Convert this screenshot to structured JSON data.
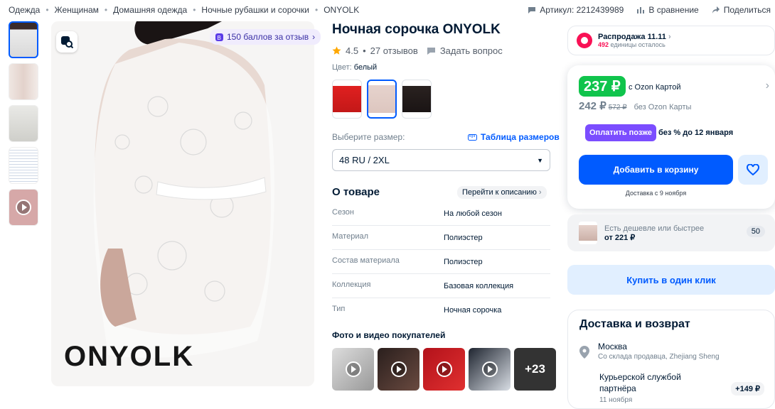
{
  "breadcrumbs": [
    "Одежда",
    "Женщинам",
    "Домашняя одежда",
    "Ночные рубашки и сорочки",
    "ONYOLK"
  ],
  "top_links": {
    "article": "Артикул: 2212439989",
    "compare": "В сравнение",
    "share": "Поделиться"
  },
  "gallery": {
    "points_badge": "150 баллов за отзыв",
    "brand_overlay": "ONYOLK"
  },
  "product": {
    "title": "Ночная сорочка ONYOLK",
    "rating": "4.5",
    "reviews": "27 отзывов",
    "ask": "Задать вопрос",
    "color_label": "Цвет:",
    "color_value": "белый",
    "size_label": "Выберите размер:",
    "size_table": "Таблица размеров",
    "size_selected": "48 RU / 2XL"
  },
  "about": {
    "title": "О товаре",
    "goto": "Перейти к описанию",
    "specs": [
      {
        "k": "Сезон",
        "v": "На любой сезон"
      },
      {
        "k": "Материал",
        "v": "Полиэстер"
      },
      {
        "k": "Состав материала",
        "v": "Полиэстер"
      },
      {
        "k": "Коллекция",
        "v": "Базовая коллекция"
      },
      {
        "k": "Тип",
        "v": "Ночная сорочка"
      }
    ]
  },
  "ugc": {
    "title": "Фото и видео покупателей",
    "more": "+23"
  },
  "sale": {
    "title": "Распродажа 11.11",
    "count": "492",
    "count_text": "единицы осталось"
  },
  "price": {
    "card_price": "237 ₽",
    "card_label": "с Ozon Картой",
    "price": "242 ₽",
    "old_price": "572 ₽",
    "no_card_label": "без Ozon Карты",
    "pay_later": "Оплатить позже",
    "pay_later_text": "без % до 12 января",
    "cart_button": "Добавить в корзину",
    "delivery_text": "Доставка с 9 ноября"
  },
  "cheaper": {
    "text": "Есть дешевле или быстрее",
    "price": "от 221 ₽",
    "count": "50"
  },
  "one_click": "Купить в один клик",
  "delivery": {
    "title": "Доставка и возврат",
    "city": "Москва",
    "warehouse": "Со склада продавца, Zhejiang Sheng",
    "courier": "Курьерской службой партнёра",
    "courier_date": "11 ноября",
    "courier_price": "+149 ₽"
  },
  "colors": {
    "accent": "#005bff",
    "green": "#10c44c",
    "purple": "#7b4dff",
    "sale_pink": "#f91155"
  }
}
